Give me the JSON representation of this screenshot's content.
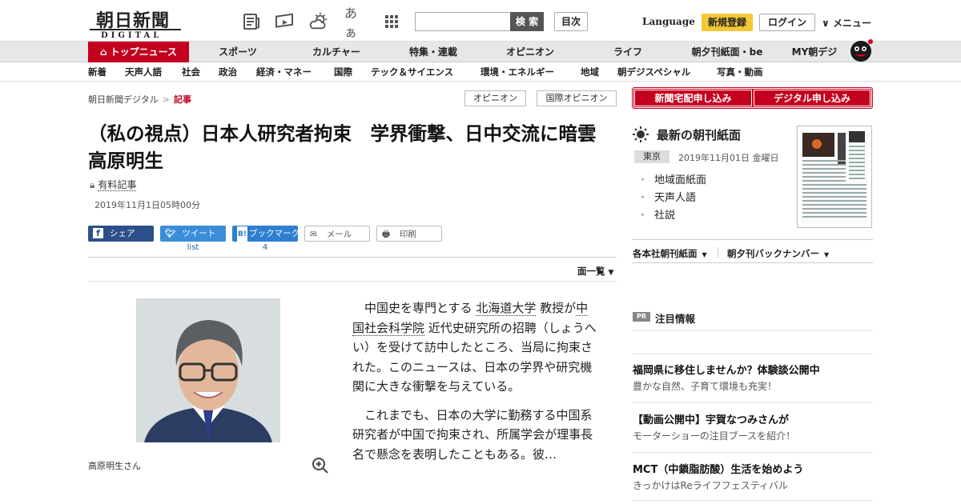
{
  "header": {
    "logo_main": "朝日新聞",
    "logo_sub": "DIGITAL",
    "search_placeholder": "",
    "search_button": "検 索",
    "toc_button": "目次",
    "language": "Language",
    "register": "新規登録",
    "login": "ログイン",
    "menu": "メニュー",
    "font_size_label": "あぁ"
  },
  "nav_primary": [
    "トップニュース",
    "スポーツ",
    "カルチャー",
    "特集・連載",
    "オピニオン",
    "ライフ",
    "朝夕刊紙面・be",
    "MY朝デジ"
  ],
  "nav_secondary": [
    "新着",
    "天声人語",
    "社会",
    "政治",
    "経済・マネー",
    "国際",
    "テック＆サイエンス",
    "環境・エネルギー",
    "地域",
    "朝デジスペシャル",
    "写真・動画"
  ],
  "breadcrumb": {
    "home": "朝日新聞デジタル",
    "separator": ">",
    "current": "記事"
  },
  "tags": [
    "オピニオン",
    "国際オピニオン"
  ],
  "article": {
    "title": "（私の視点）日本人研究者拘束　学界衝撃、日中交流に暗雲　高原明生",
    "paid_label": "有料記事",
    "date": "2019年11月1日05時00分",
    "share": {
      "facebook": "シェア",
      "twitter": "ツイート",
      "bookmark": "ブックマーク",
      "mail": "メール",
      "print": "印刷",
      "twitter_count": "list",
      "bookmark_count": "4"
    },
    "page_list": "面一覧",
    "photo_caption": "高原明生さん",
    "para1_pre": "中国史を専門とする",
    "para1_link1": "北海道大学",
    "para1_mid": "教授が",
    "para1_link2": "中国社会科学院",
    "para1_post": "近代史研究所の招聘（しょうへい）を受けて訪中したところ、当局に拘束された。このニュースは、日本の学界や研究機関に大きな衝撃を与えている。",
    "para2": "これまでも、日本の大学に勤務する中国系研究者が中国で拘束され、所属学会が理事長名で懸念を表明したこともある。彼…"
  },
  "sidebar": {
    "subscribe_paper": "新聞宅配申し込み",
    "subscribe_digital": "デジタル申し込み",
    "paper_title": "最新の朝刊紙面",
    "edition": "東京",
    "paper_date": "2019年11月01日 金曜日",
    "paper_links": [
      "地域面紙面",
      "天声人語",
      "社説"
    ],
    "dropdown1": "各本社朝刊紙面",
    "dropdown2": "朝夕刊バックナンバー",
    "pr_badge": "PR",
    "pr_title": "注目情報",
    "pr_items": [
      {
        "head": "福岡県に移住しませんか？体験談公開中",
        "sub": "豊かな自然、子育て環境も充実！"
      },
      {
        "head": "【動画公開中】宇賀なつみさんが",
        "sub": "モーターショーの注目ブースを紹介！"
      },
      {
        "head": "MCT（中鎖脂肪酸）生活を始めよう",
        "sub": "きっかけはReライフフェスティバル"
      }
    ]
  },
  "colors": {
    "brand_red": "#c4001f",
    "register_yellow": "#f3c936",
    "facebook_blue": "#2d4f8a",
    "twitter_blue": "#3a8ed8",
    "hatena_blue": "#2f7fd1"
  }
}
